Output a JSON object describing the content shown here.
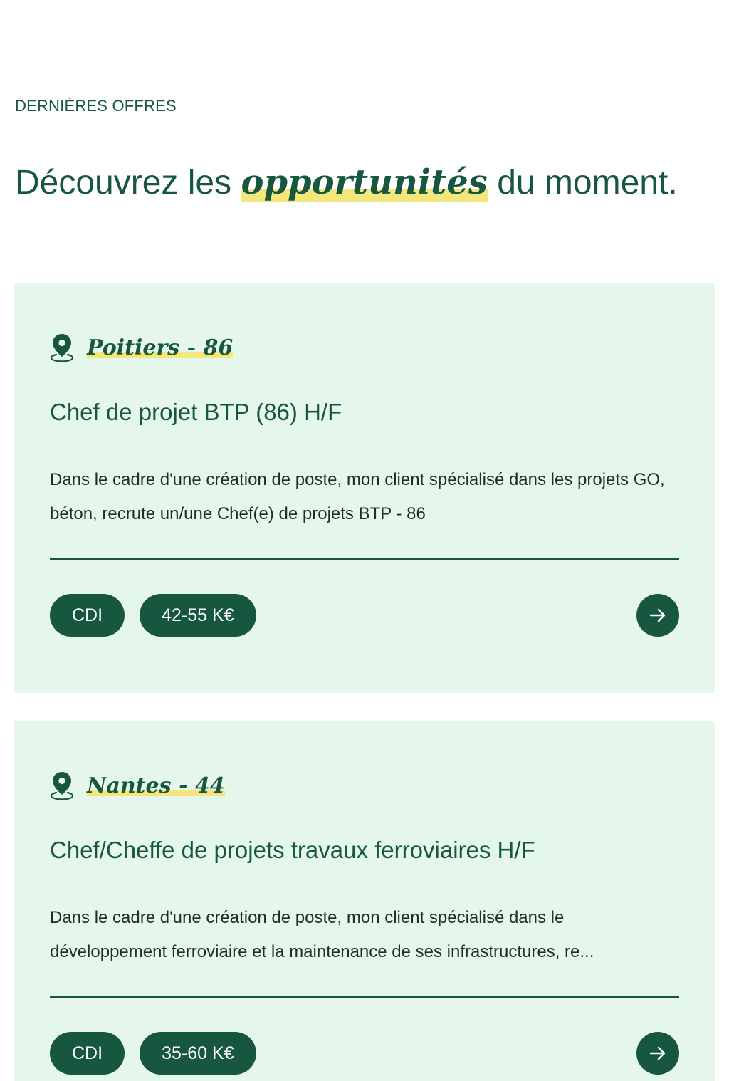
{
  "section": {
    "eyebrow": "DERNIÈRES OFFRES",
    "headline_before": "Découvrez les ",
    "headline_emphasis": "opportunités",
    "headline_after": " du moment."
  },
  "colors": {
    "primary": "#18573f",
    "card_background": "#e5f7eb",
    "highlight": "#f3e67a"
  },
  "offers": [
    {
      "location": "Poitiers - 86",
      "title": "Chef de projet BTP (86) H/F",
      "description": "Dans le cadre d'une création de poste, mon client spécialisé dans les projets GO, béton, recrute un/une Chef(e) de projets BTP - 86",
      "contract": "CDI",
      "salary": "42-55 K€",
      "icon": "location-pin-icon",
      "action_icon": "arrow-right-icon"
    },
    {
      "location": "Nantes - 44",
      "title": "Chef/Cheffe de projets travaux ferroviaires H/F",
      "description": "Dans le cadre d'une création de poste, mon client spécialisé dans le développement ferroviaire et la maintenance de ses infrastructures, re...",
      "contract": "CDI",
      "salary": "35-60 K€",
      "icon": "location-pin-icon",
      "action_icon": "arrow-right-icon"
    }
  ]
}
